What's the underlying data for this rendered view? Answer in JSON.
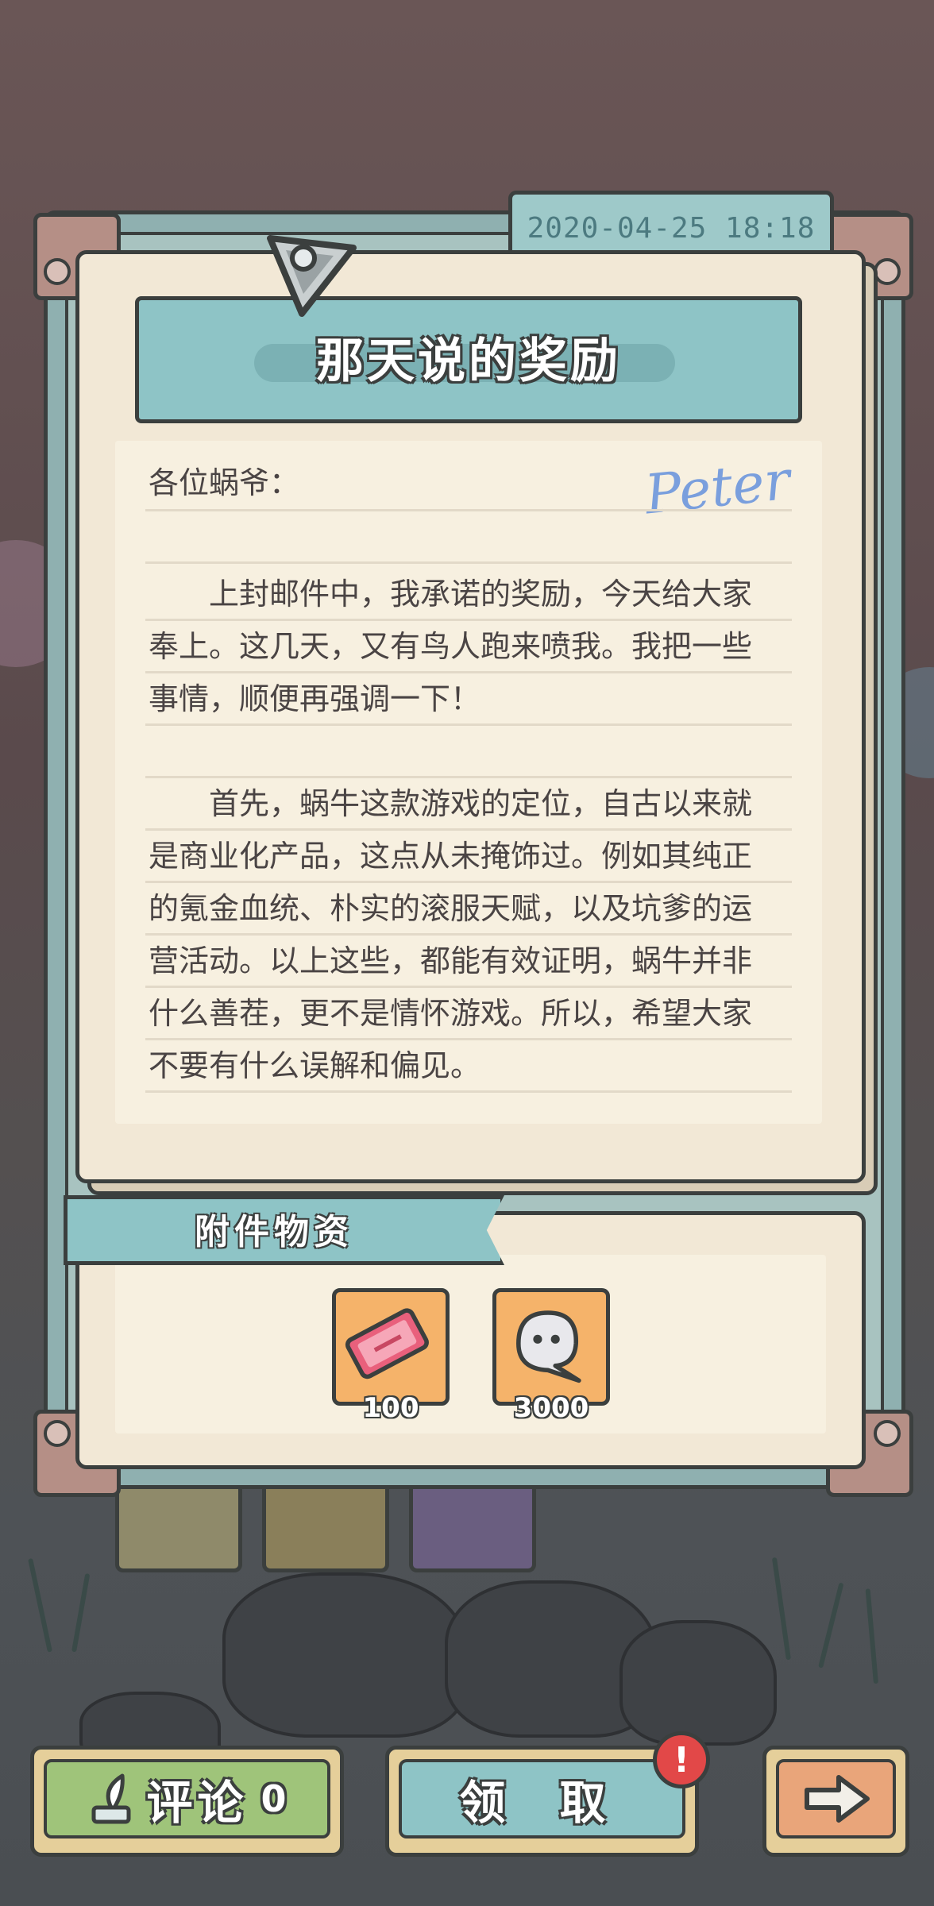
{
  "mail": {
    "date": "2020-04-25  18:18",
    "title": "那天说的奖励",
    "signature": "Peter",
    "greeting": "各位蜗爷：",
    "lines": [
      "　　上封邮件中，我承诺的奖励，今天给大家",
      "奉上。这几天，又有鸟人跑来喷我。我把一些",
      "事情，顺便再强调一下！",
      "",
      "　　首先，蜗牛这款游戏的定位，自古以来就",
      "是商业化产品，这点从未掩饰过。例如其纯正",
      "的氪金血统、朴实的滚服天赋，以及坑爹的运",
      "营活动。以上这些，都能有效证明，蜗牛并非",
      "什么善茬，更不是情怀游戏。所以，希望大家",
      "不要有什么误解和偏见。"
    ]
  },
  "attachments": {
    "title": "附件物资",
    "items": [
      {
        "icon": "ticket-icon",
        "count": "100"
      },
      {
        "icon": "ghost-icon",
        "count": "3000"
      }
    ]
  },
  "buttons": {
    "comment_label": "评论",
    "comment_count": "0",
    "claim_label": "领 取",
    "claim_badge": "!"
  },
  "colors": {
    "accent": "#8ec4c6",
    "paper": "#f2e8d6",
    "item_bg": "#f5b36a",
    "badge": "#e24848"
  }
}
